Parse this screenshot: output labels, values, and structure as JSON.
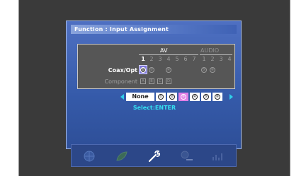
{
  "title": "Function : Input Assignment",
  "table": {
    "group_av": "AV",
    "group_audio": "AUDIO",
    "av_numbers": [
      "1",
      "2",
      "3",
      "4",
      "5",
      "6",
      "7"
    ],
    "audio_numbers": [
      "1",
      "2",
      "3",
      "4"
    ],
    "selected_column": "1",
    "row_coax": "Coax/Opt",
    "row_component": "Component",
    "coax_av_marks": [
      "①",
      "②",
      "",
      "④",
      "",
      "",
      ""
    ],
    "coax_audio_marks": [
      "⑤",
      "⑥",
      "",
      ""
    ],
    "component_marks": [
      "A",
      "B",
      "C",
      "D"
    ]
  },
  "selector": {
    "none_label": "None",
    "options": [
      "①",
      "②",
      "③",
      "④",
      "⑤",
      "⑥"
    ],
    "highlighted_index": 2
  },
  "hint": "Select:ENTER",
  "toolbar_icons": [
    "globe-icon",
    "leaf-icon",
    "wrench-icon",
    "abc-icon",
    "signal-icon"
  ],
  "colors": {
    "panel": "#355aa9",
    "accent_cyan": "#35e0f0",
    "highlight": "#e27fe6"
  }
}
